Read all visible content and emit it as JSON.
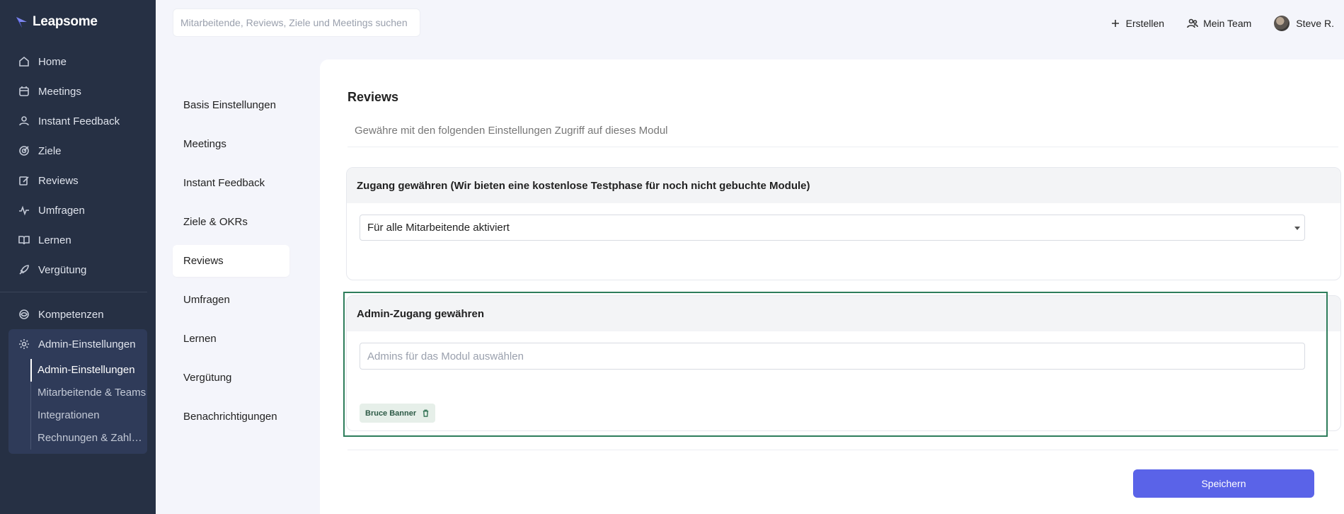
{
  "brand": {
    "name": "Leapsome"
  },
  "sidebar": {
    "items": [
      {
        "label": "Home",
        "icon": "home-icon"
      },
      {
        "label": "Meetings",
        "icon": "calendar-icon"
      },
      {
        "label": "Instant Feedback",
        "icon": "feedback-icon"
      },
      {
        "label": "Ziele",
        "icon": "target-icon"
      },
      {
        "label": "Reviews",
        "icon": "edit-icon"
      },
      {
        "label": "Umfragen",
        "icon": "pulse-icon"
      },
      {
        "label": "Lernen",
        "icon": "book-icon"
      },
      {
        "label": "Vergütung",
        "icon": "rocket-icon"
      }
    ],
    "kompetenzen": "Kompetenzen",
    "admin": {
      "label": "Admin-Einstellungen",
      "sub_items": [
        "Admin-Einstellungen",
        "Mitarbeitende & Teams",
        "Integrationen",
        "Rechnungen & Zahlungen"
      ]
    }
  },
  "header": {
    "search_placeholder": "Mitarbeitende, Reviews, Ziele und Meetings suchen",
    "create_label": "Erstellen",
    "team_label": "Mein Team",
    "user_name": "Steve R."
  },
  "settings_nav": {
    "items": [
      "Basis Einstellungen",
      "Meetings",
      "Instant Feedback",
      "Ziele & OKRs",
      "Reviews",
      "Umfragen",
      "Lernen",
      "Vergütung",
      "Benachrichtigungen"
    ],
    "active": "Reviews"
  },
  "main": {
    "title": "Reviews",
    "subtitle": "Gewähre mit den folgenden Einstellungen Zugriff auf dieses Modul",
    "access": {
      "heading": "Zugang gewähren (Wir bieten eine kostenlose Testphase für noch nicht gebuchte Module)",
      "selected": "Für alle Mitarbeitende aktiviert"
    },
    "admin_access": {
      "heading": "Admin-Zugang gewähren",
      "placeholder": "Admins für das Modul auswählen",
      "tags": [
        "Bruce Banner"
      ]
    },
    "save_label": "Speichern"
  },
  "colors": {
    "sidebar_bg": "#263044",
    "accent": "#5a63e8",
    "highlight": "#2e7d5b"
  }
}
